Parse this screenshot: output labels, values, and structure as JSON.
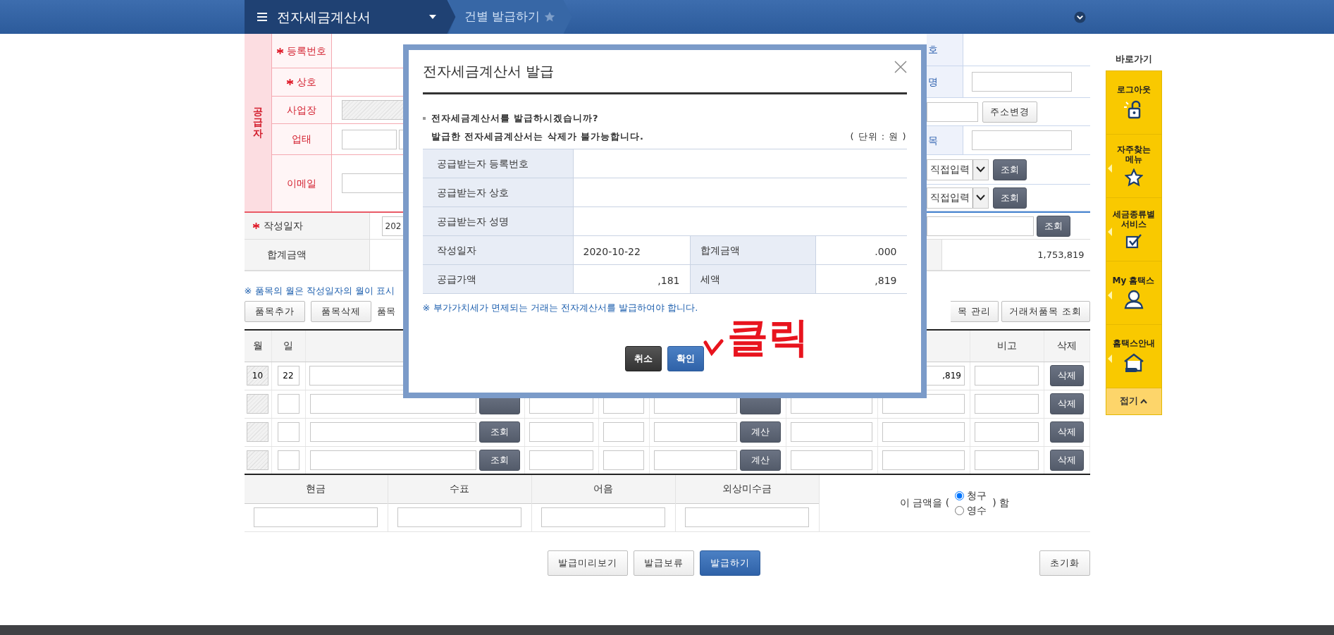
{
  "topbar": {
    "menu_title": "전자세금계산서",
    "breadcrumb": "건별 발급하기"
  },
  "supplier": {
    "section_label": "공급자",
    "rows": [
      {
        "label": "등록번호",
        "required": true,
        "kind": "text"
      },
      {
        "label": "상호",
        "required": true,
        "kind": "text"
      },
      {
        "label": "사업장",
        "required": false,
        "kind": "readonly"
      },
      {
        "label": "업태",
        "required": false,
        "kind": "double"
      },
      {
        "label": "이메일",
        "required": false,
        "kind": "input"
      }
    ]
  },
  "receiver": {
    "rows": [
      {
        "kind": "label",
        "label": "호"
      },
      {
        "kind": "input",
        "label": "명"
      },
      {
        "kind": "address",
        "button": "주소변경"
      },
      {
        "kind": "input",
        "label": "목"
      },
      {
        "kind": "select",
        "value": "직접입력",
        "button": "조회"
      },
      {
        "kind": "select",
        "value": "직접입력",
        "button": "조회"
      }
    ]
  },
  "date_row": {
    "label": "작성일자",
    "required": true,
    "value": "202",
    "button": "조회"
  },
  "total_row": {
    "label": "합계금액",
    "value": "1,753,819"
  },
  "item_note": "※ 품목의 월은 작성일자의 월이 표시",
  "item_buttons": [
    "품목추가",
    "품목삭제"
  ],
  "item_label": "품목",
  "right_buttons": [
    "목 관리",
    "거래처품목 조회"
  ],
  "items_table": {
    "header_left": [
      "월",
      "일"
    ],
    "header_right": [
      "비고",
      "삭제"
    ],
    "rows": [
      {
        "kind": "first",
        "month": "10",
        "day": "22",
        "tax": ",819",
        "delete": "삭제"
      },
      {
        "kind": "partial",
        "delete": "삭제"
      },
      {
        "kind": "full",
        "lookup": "조회",
        "calc": "계산",
        "delete": "삭제"
      },
      {
        "kind": "full",
        "lookup": "조회",
        "calc": "계산",
        "delete": "삭제"
      }
    ]
  },
  "payment": {
    "columns": [
      "현금",
      "수표",
      "어음",
      "외상미수금"
    ],
    "prefix": "이 금액을 (",
    "suffix": ") 함",
    "options": [
      {
        "label": "청구",
        "selected": true
      },
      {
        "label": "영수",
        "selected": false
      }
    ]
  },
  "bottom_buttons": [
    {
      "label": "발급미리보기",
      "kind": "default"
    },
    {
      "label": "발급보류",
      "kind": "default"
    },
    {
      "label": "발급하기",
      "kind": "primary"
    }
  ],
  "reset_button": "초기화",
  "quick_menu": {
    "title": "바로가기",
    "items": [
      {
        "label": "로그아웃",
        "kind": "lock",
        "submenu": false
      },
      {
        "label": "자주찾는 메뉴",
        "kind": "star",
        "submenu": true
      },
      {
        "label": "세금종류별 서비스",
        "kind": "check",
        "submenu": true
      },
      {
        "label": "My 홈택스",
        "kind": "person",
        "submenu": true
      },
      {
        "label": "홈택스안내",
        "kind": "house",
        "submenu": true
      }
    ],
    "collapse": "접기"
  },
  "modal": {
    "title": "전자세금계산서 발급",
    "question": "전자세금계산서를 발급하시겠습니까?",
    "warning": "발급한 전자세금계산서는 삭제가 불가능합니다.",
    "unit": "( 단위 : 원 )",
    "rows": [
      {
        "kind": "wide",
        "label": "공급받는자 등록번호"
      },
      {
        "kind": "wide",
        "label": "공급받는자 상호"
      },
      {
        "kind": "wide",
        "label": "공급받는자 성명"
      },
      {
        "kind": "date",
        "label": "작성일자",
        "value": "2020-10-22",
        "label2": "합계금액",
        "value2": ".000"
      },
      {
        "kind": "amount",
        "label": "공급가액",
        "value": ",181",
        "label2": "세액",
        "value2": ",819"
      }
    ],
    "note": "※ 부가가치세가 면제되는 거래는 전자계산서를 발급하여야 합니다.",
    "buttons": [
      {
        "label": "취소",
        "kind": "dark"
      },
      {
        "label": "확인",
        "kind": "primary"
      }
    ],
    "annotation": "클릭"
  }
}
